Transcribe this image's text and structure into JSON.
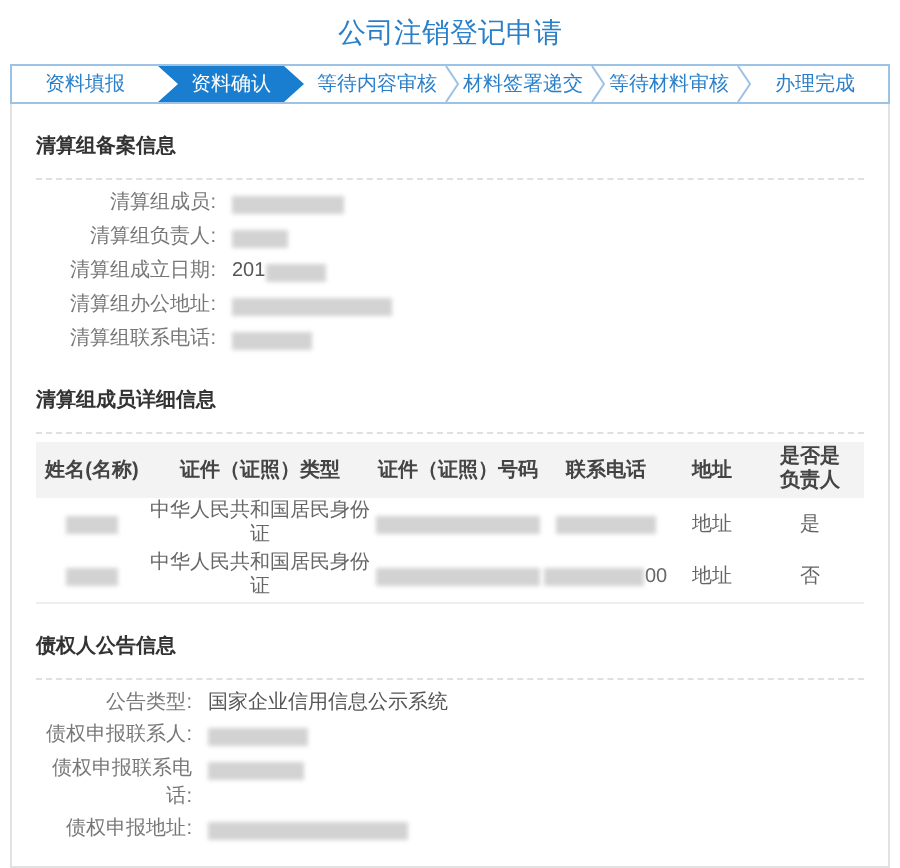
{
  "title": "公司注销登记申请",
  "steps": [
    {
      "label": "资料填报",
      "selected": false
    },
    {
      "label": "资料确认",
      "selected": true
    },
    {
      "label": "等待内容审核",
      "selected": false
    },
    {
      "label": "材料签署递交",
      "selected": false
    },
    {
      "label": "等待材料审核",
      "selected": false
    },
    {
      "label": "办理完成",
      "selected": false
    }
  ],
  "filing_section": {
    "heading": "清算组备案信息",
    "fields": [
      {
        "label": "清算组成员:",
        "redacted": true
      },
      {
        "label": "清算组负责人:",
        "redacted": true
      },
      {
        "label": "清算组成立日期:",
        "value": "201",
        "redacted": true
      },
      {
        "label": "清算组办公地址:",
        "redacted": true
      },
      {
        "label": "清算组联系电话:",
        "redacted": true
      }
    ]
  },
  "members_section": {
    "heading": "清算组成员详细信息",
    "columns": [
      "姓名(名称)",
      "证件（证照）类型",
      "证件（证照）号码",
      "联系电话",
      "地址",
      "是否是负责人"
    ],
    "rows": [
      {
        "cells": [
          {
            "redacted": true
          },
          {
            "value": "中华人民共和国居民身份证"
          },
          {
            "redacted": true
          },
          {
            "redacted": true
          },
          {
            "value": "地址"
          },
          {
            "value": "是"
          }
        ]
      },
      {
        "cells": [
          {
            "redacted": true
          },
          {
            "value": "中华人民共和国居民身份证"
          },
          {
            "redacted": true
          },
          {
            "redacted": true,
            "value": "00"
          },
          {
            "value": "地址"
          },
          {
            "value": "否"
          }
        ]
      }
    ]
  },
  "notice_section": {
    "heading": "债权人公告信息",
    "fields": [
      {
        "label": "公告类型:",
        "value": "国家企业信用信息公示系统"
      },
      {
        "label": "债权申报联系人:",
        "redacted": true
      },
      {
        "label": "债权申报联系电话:",
        "redacted": true
      },
      {
        "label": "债权申报地址:",
        "redacted": true
      }
    ]
  }
}
